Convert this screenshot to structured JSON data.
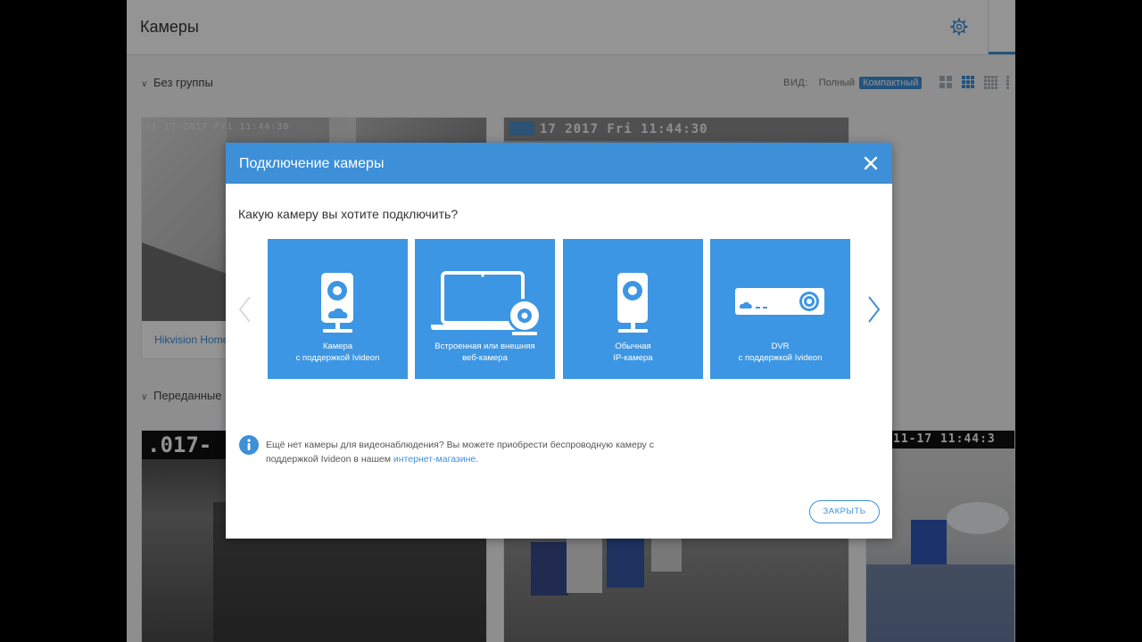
{
  "header": {
    "title": "Камеры",
    "settings_icon": "gear-icon"
  },
  "group_no_group": {
    "label": "Без группы"
  },
  "group_shared": {
    "label": "Переданные к"
  },
  "view_switch": {
    "label": "ВИД:",
    "full": "Полный",
    "compact": "Компактный",
    "active": "compact"
  },
  "cameras": {
    "row1": [
      {
        "osd": "11-17-2017 Fri 11:44:30",
        "caption": "Hikvision Home"
      },
      {
        "osd": "17 2017 Fri 11:44:30"
      }
    ],
    "row2": [
      {
        "osd": ".017-"
      },
      {
        "osd": ""
      },
      {
        "osd": "11-17 11:44:3"
      }
    ]
  },
  "modal": {
    "title": "Подключение камеры",
    "question": "Какую камеру вы хотите подключить?",
    "cards": [
      {
        "line1": "Камера",
        "line2": "с поддержкой Ivideon",
        "icon": "ivideon-camera-icon"
      },
      {
        "line1": "Встроенная или внешняя",
        "line2": "веб-камера",
        "icon": "laptop-webcam-icon"
      },
      {
        "line1": "Обычная",
        "line2": "IP-камера",
        "icon": "ip-camera-icon"
      },
      {
        "line1": "DVR",
        "line2": "с поддержкой Ivideon",
        "icon": "dvr-icon"
      }
    ],
    "info_text": "Ещё нет камеры для видеонаблюдения? Вы можете приобрести беспроводную камеру с поддержкой Ivideon в нашем ",
    "info_link": "интернет-магазине",
    "info_tail": ".",
    "close_button": "ЗАКРЫТЬ"
  },
  "colors": {
    "accent": "#3d8fd8",
    "card": "#3d96e3",
    "header_text": "#333333"
  }
}
